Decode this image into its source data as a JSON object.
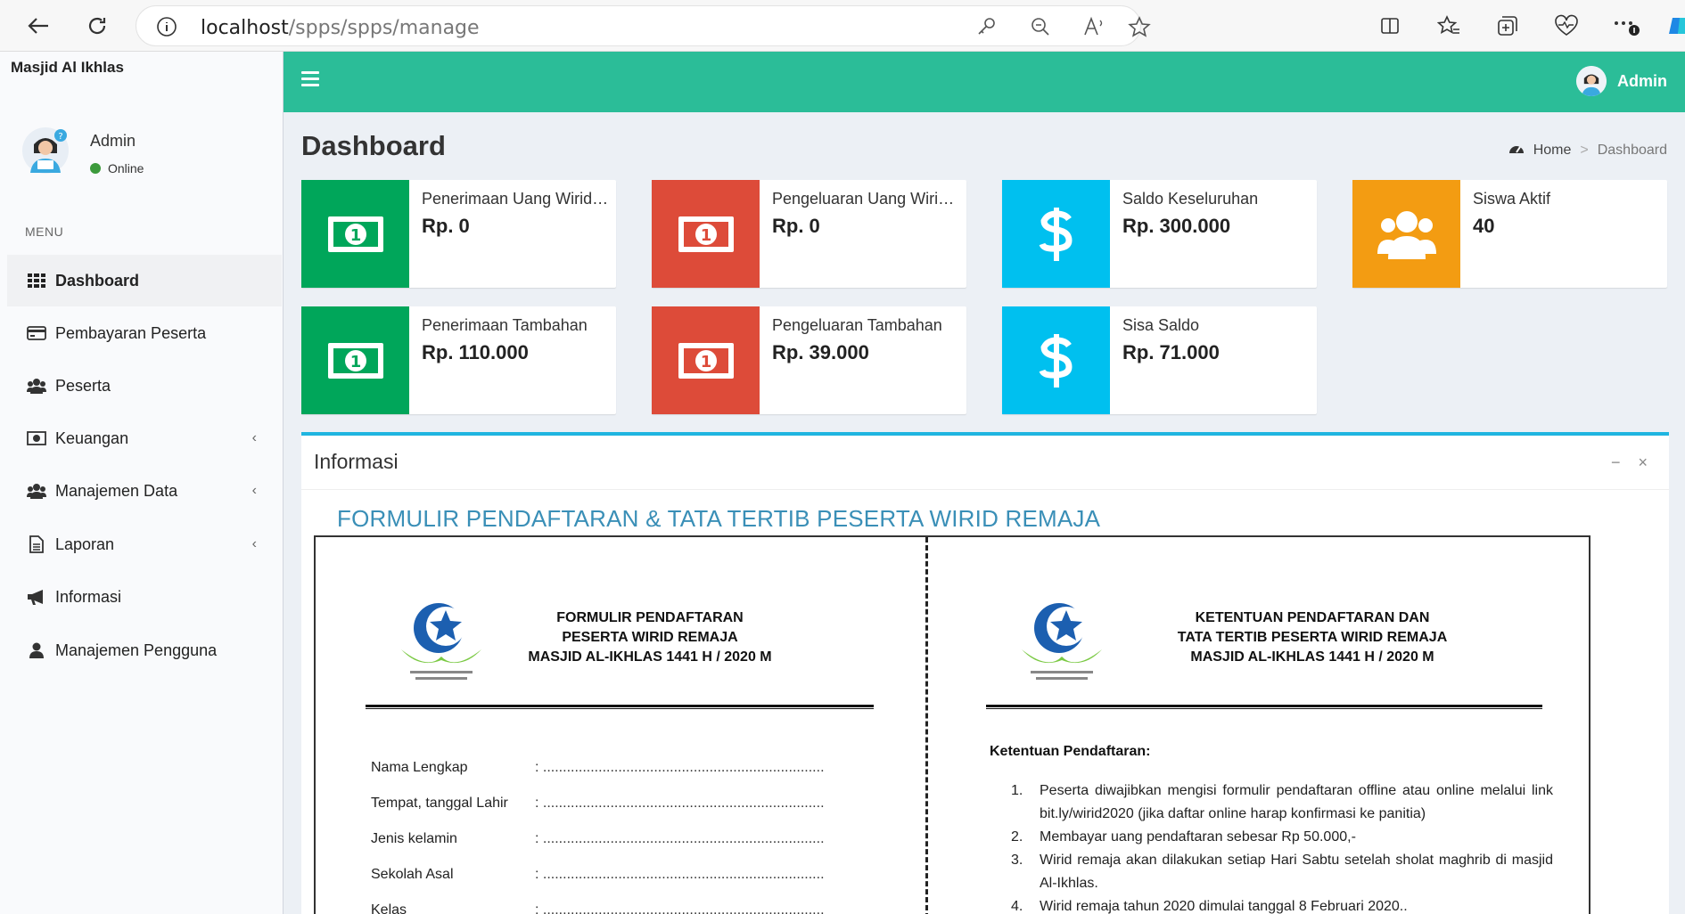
{
  "browser": {
    "url_host": "localhost",
    "url_path": "/spps/spps/manage"
  },
  "sidebar": {
    "brand": "Masjid Al Ikhlas",
    "user_name": "Admin",
    "user_status": "Online",
    "menu_header": "MENU",
    "items": [
      {
        "label": "Dashboard",
        "icon": "grid-icon",
        "active": true,
        "has_children": false
      },
      {
        "label": "Pembayaran Peserta",
        "icon": "credit-card-icon",
        "active": false,
        "has_children": false
      },
      {
        "label": "Peserta",
        "icon": "users-icon",
        "active": false,
        "has_children": false
      },
      {
        "label": "Keuangan",
        "icon": "money-icon",
        "active": false,
        "has_children": true
      },
      {
        "label": "Manajemen Data",
        "icon": "users-icon",
        "active": false,
        "has_children": true
      },
      {
        "label": "Laporan",
        "icon": "file-icon",
        "active": false,
        "has_children": true
      },
      {
        "label": "Informasi",
        "icon": "bullhorn-icon",
        "active": false,
        "has_children": false
      },
      {
        "label": "Manajemen Pengguna",
        "icon": "user-icon",
        "active": false,
        "has_children": false
      }
    ],
    "chevron": "‹"
  },
  "topbar": {
    "user_label": "Admin",
    "accent": "#2bbd98"
  },
  "header": {
    "title": "Dashboard",
    "breadcrumb_home": "Home",
    "breadcrumb_sep": ">",
    "breadcrumb_current": "Dashboard"
  },
  "info_boxes": [
    {
      "label": "Penerimaan Uang Wirid Remaja",
      "value": "Rp. 0",
      "color": "#00a65a",
      "icon": "money-bill-icon"
    },
    {
      "label": "Pengeluaran Uang Wirid Remaja",
      "value": "Rp. 0",
      "color": "#dd4b39",
      "icon": "money-bill-icon"
    },
    {
      "label": "Saldo Keseluruhan",
      "value": "Rp. 300.000",
      "color": "#00c0ef",
      "icon": "dollar-icon"
    },
    {
      "label": "Siswa Aktif",
      "value": "40",
      "color": "#f39c12",
      "icon": "users-icon"
    },
    {
      "label": "Penerimaan Tambahan",
      "value": "Rp. 110.000",
      "color": "#00a65a",
      "icon": "money-bill-icon"
    },
    {
      "label": "Pengeluaran Tambahan",
      "value": "Rp. 39.000",
      "color": "#dd4b39",
      "icon": "money-bill-icon"
    },
    {
      "label": "Sisa Saldo",
      "value": "Rp. 71.000",
      "color": "#00c0ef",
      "icon": "dollar-icon"
    }
  ],
  "panel": {
    "title": "Informasi",
    "minimize": "−",
    "close": "×",
    "heading": "FORMULIR PENDAFTARAN & TATA TERTIB PESERTA WIRID REMAJA"
  },
  "doc": {
    "left_title": [
      "FORMULIR PENDAFTARAN",
      "PESERTA WIRID REMAJA",
      "MASJID AL-IKHLAS 1441 H / 2020 M"
    ],
    "right_title": [
      "KETENTUAN PENDAFTARAN DAN",
      "TATA TERTIB PESERTA WIRID REMAJA",
      "MASJID AL-IKHLAS 1441 H / 2020 M"
    ],
    "fields": [
      "Nama Lengkap",
      "Tempat, tanggal Lahir",
      "Jenis kelamin",
      "Sekolah Asal",
      "Kelas"
    ],
    "field_dots": ": .......................................................................",
    "rules_heading": "Ketentuan Pendaftaran:",
    "rules": [
      {
        "n": "1.",
        "text": "Peserta diwajibkan mengisi formulir pendaftaran offline atau online melalui link bit.ly/wirid2020 (jika daftar online harap konfirmasi ke panitia)"
      },
      {
        "n": "2.",
        "text": "Membayar uang pendaftaran sebesar Rp 50.000,-"
      },
      {
        "n": "3.",
        "text": "Wirid remaja akan dilakukan setiap Hari Sabtu setelah sholat maghrib di masjid Al-Ikhlas."
      },
      {
        "n": "4.",
        "text": "Wirid remaja tahun 2020 dimulai tanggal 8 Februari 2020.."
      }
    ]
  }
}
